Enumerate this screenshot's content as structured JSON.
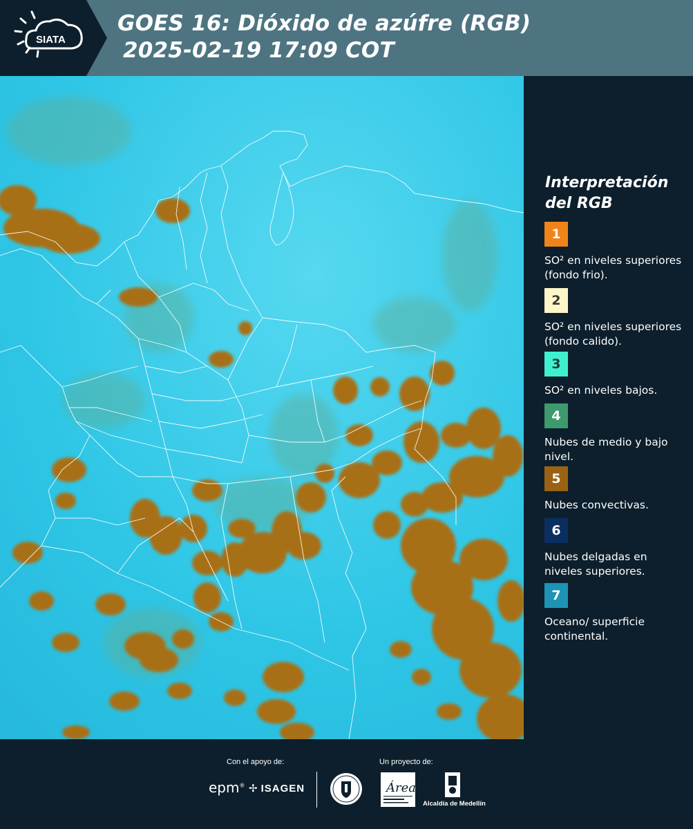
{
  "header": {
    "logo_text": "SIATA",
    "title_line1": "GOES 16: Dióxido de azúfre (RGB)",
    "title_line2": "2025-02-19 17:09 COT"
  },
  "legend": {
    "title_line1": "Interpretación",
    "title_line2": "del RGB",
    "items": [
      {
        "number": "1",
        "color": "#f08419",
        "text_color": "#ffffff",
        "label": "SO² en niveles superiores (fondo frio)."
      },
      {
        "number": "2",
        "color": "#fdf6c6",
        "text_color": "#3b3b3b",
        "label": "SO² en niveles superiores (fondo calido)."
      },
      {
        "number": "3",
        "color": "#3ff0cf",
        "text_color": "#1c3b3a",
        "label": "SO² en niveles bajos."
      },
      {
        "number": "4",
        "color": "#3c9a6c",
        "text_color": "#ffffff",
        "label": "Nubes de medio y bajo nivel."
      },
      {
        "number": "5",
        "color": "#9a6314",
        "text_color": "#ffffff",
        "label": "Nubes convectivas."
      },
      {
        "number": "6",
        "color": "#0b2e60",
        "text_color": "#ffffff",
        "label": "Nubes delgadas en niveles superiores."
      },
      {
        "number": "7",
        "color": "#1d93b5",
        "text_color": "#ffffff",
        "label": "Oceano/ superficie continental."
      }
    ]
  },
  "map": {
    "background_color": "#2fc6e6",
    "cloud_color": "#a86f18",
    "border_color": "#ffffff"
  },
  "footer": {
    "support_label": "Con el apoyo de:",
    "project_label": "Un proyecto de:",
    "sponsor_1": "epm",
    "sponsor_2": "ISAGEN",
    "partner_1": "Área Metropolitana Valle de Aburrá",
    "partner_2": "Alcaldía de Medellín"
  }
}
